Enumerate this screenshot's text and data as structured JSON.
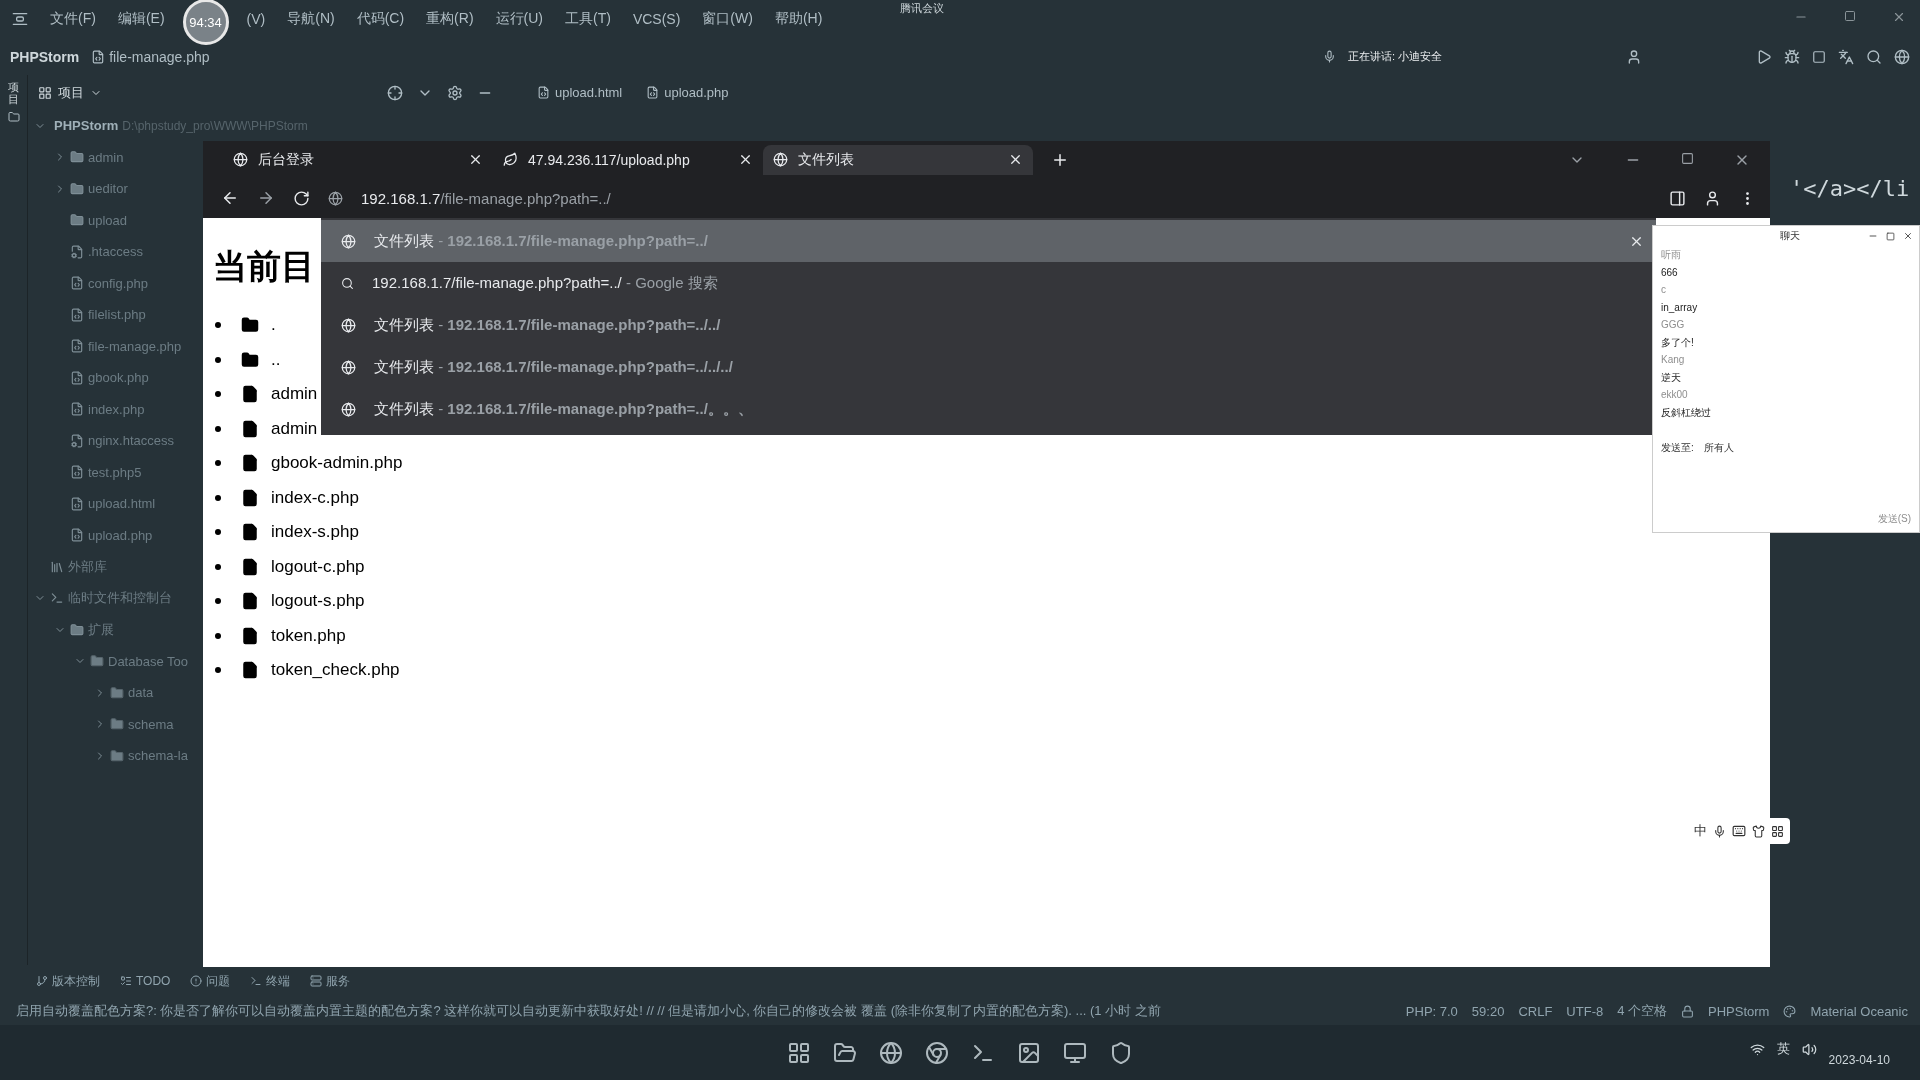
{
  "menu": [
    "文件(F)",
    "编辑(E)",
    "(V)",
    "导航(N)",
    "代码(C)",
    "重构(R)",
    "运行(U)",
    "工具(T)",
    "VCS(S)",
    "窗口(W)",
    "帮助(H)"
  ],
  "timer": "94:34",
  "meeting_label": "腾讯会议",
  "breadcrumb": {
    "project": "PHPStorm",
    "file": "file-manage.php"
  },
  "speaking": "正在讲话: 小迪安全",
  "project_panel": {
    "title": "项目",
    "strip_label": "项目"
  },
  "tree": [
    {
      "label": "PHPStorm",
      "path": "D:\\phpstudy_pro\\WWW\\PHPStorm",
      "kind": "folder",
      "expanded": true,
      "children": [
        {
          "label": "admin",
          "kind": "folder",
          "expanded": false
        },
        {
          "label": "ueditor",
          "kind": "folder",
          "expanded": false
        },
        {
          "label": "upload",
          "kind": "folder"
        },
        {
          "label": ".htaccess",
          "kind": "config"
        },
        {
          "label": "config.php",
          "kind": "php"
        },
        {
          "label": "filelist.php",
          "kind": "php"
        },
        {
          "label": "file-manage.php",
          "kind": "php"
        },
        {
          "label": "gbook.php",
          "kind": "php"
        },
        {
          "label": "index.php",
          "kind": "php"
        },
        {
          "label": "nginx.htaccess",
          "kind": "config"
        },
        {
          "label": "test.php5",
          "kind": "php"
        },
        {
          "label": "upload.html",
          "kind": "php"
        },
        {
          "label": "upload.php",
          "kind": "php"
        }
      ]
    },
    {
      "label": "外部库",
      "kind": "library"
    },
    {
      "label": "临时文件和控制台",
      "kind": "scratch",
      "expanded": true,
      "children": [
        {
          "label": "扩展",
          "kind": "folder",
          "expanded": true,
          "children": [
            {
              "label": "Database Too",
              "kind": "folder",
              "expanded": true,
              "children": [
                {
                  "label": "data",
                  "kind": "folder",
                  "expanded": false
                },
                {
                  "label": "schema",
                  "kind": "folder",
                  "expanded": false
                },
                {
                  "label": "schema-la",
                  "kind": "folder",
                  "expanded": false
                }
              ]
            }
          ]
        }
      ]
    }
  ],
  "editor_tabs": [
    {
      "label": "upload.html"
    },
    {
      "label": "upload.php"
    }
  ],
  "editor_code": "'</a></li",
  "browser": {
    "tabs": [
      {
        "title": "后台登录",
        "selected": false
      },
      {
        "title": "47.94.236.117/upload.php",
        "selected": false
      },
      {
        "title": "文件列表",
        "selected": true
      }
    ],
    "address": {
      "host": "192.168.1.7",
      "path": "/file-manage.php?path=../"
    },
    "suggestions": [
      {
        "kind": "page",
        "title": "文件列表",
        "sep": "-",
        "url": "192.168.1.7/file-manage.php?path=../",
        "selected": true
      },
      {
        "kind": "search",
        "title": "192.168.1.7/file-manage.php?path=../",
        "sep": "-",
        "url": "Google 搜索",
        "selected": false
      },
      {
        "kind": "page",
        "title": "文件列表",
        "sep": "-",
        "url": "192.168.1.7/file-manage.php?path=../../",
        "selected": false
      },
      {
        "kind": "page",
        "title": "文件列表",
        "sep": "-",
        "url": "192.168.1.7/file-manage.php?path=../../../",
        "selected": false
      },
      {
        "kind": "page",
        "title": "文件列表",
        "sep": "-",
        "url": "192.168.1.7/file-manage.php?path=../。。、",
        "selected": false
      }
    ],
    "heading": "当前目",
    "files": [
      {
        "name": ".",
        "kind": "folder"
      },
      {
        "name": "..",
        "kind": "folder"
      },
      {
        "name": "admin",
        "kind": "file"
      },
      {
        "name": "admin",
        "kind": "file"
      },
      {
        "name": "gbook-admin.php",
        "kind": "file"
      },
      {
        "name": "index-c.php",
        "kind": "file"
      },
      {
        "name": "index-s.php",
        "kind": "file"
      },
      {
        "name": "logout-c.php",
        "kind": "file"
      },
      {
        "name": "logout-s.php",
        "kind": "file"
      },
      {
        "name": "token.php",
        "kind": "file"
      },
      {
        "name": "token_check.php",
        "kind": "file"
      }
    ]
  },
  "chat": {
    "title": "聊天",
    "messages": [
      {
        "name": "听雨",
        "text": "666"
      },
      {
        "name": "c",
        "text": "in_array"
      },
      {
        "name": "GGG",
        "text": "多了个!"
      },
      {
        "name": "Kang",
        "text": "逆天"
      },
      {
        "name": "ekk00",
        "text": "反斜杠绕过"
      }
    ],
    "send_to_label": "发送至:",
    "send_to": "所有人",
    "send_button": "发送(S)"
  },
  "ime": {
    "mode": "中"
  },
  "tool_windows": [
    "版本控制",
    "TODO",
    "问题",
    "终端",
    "服务"
  ],
  "status": {
    "message": "启用自动覆盖配色方案?: 你是否了解你可以自动覆盖内置主题的配色方案? 这样你就可以自动更新中获取好处! // // 但是请加小心, 你自己的修改会被 覆盖 (除非你复制了内置的配色方案). ... (1 小时 之前",
    "items": [
      "PHP: 7.0",
      "59:20",
      "CRLF",
      "UTF-8",
      "4 个空格"
    ],
    "project": "PHPStorm",
    "theme": "Material Oceanic"
  },
  "taskbar": {
    "lang": "英",
    "date": "2023-04-10"
  }
}
